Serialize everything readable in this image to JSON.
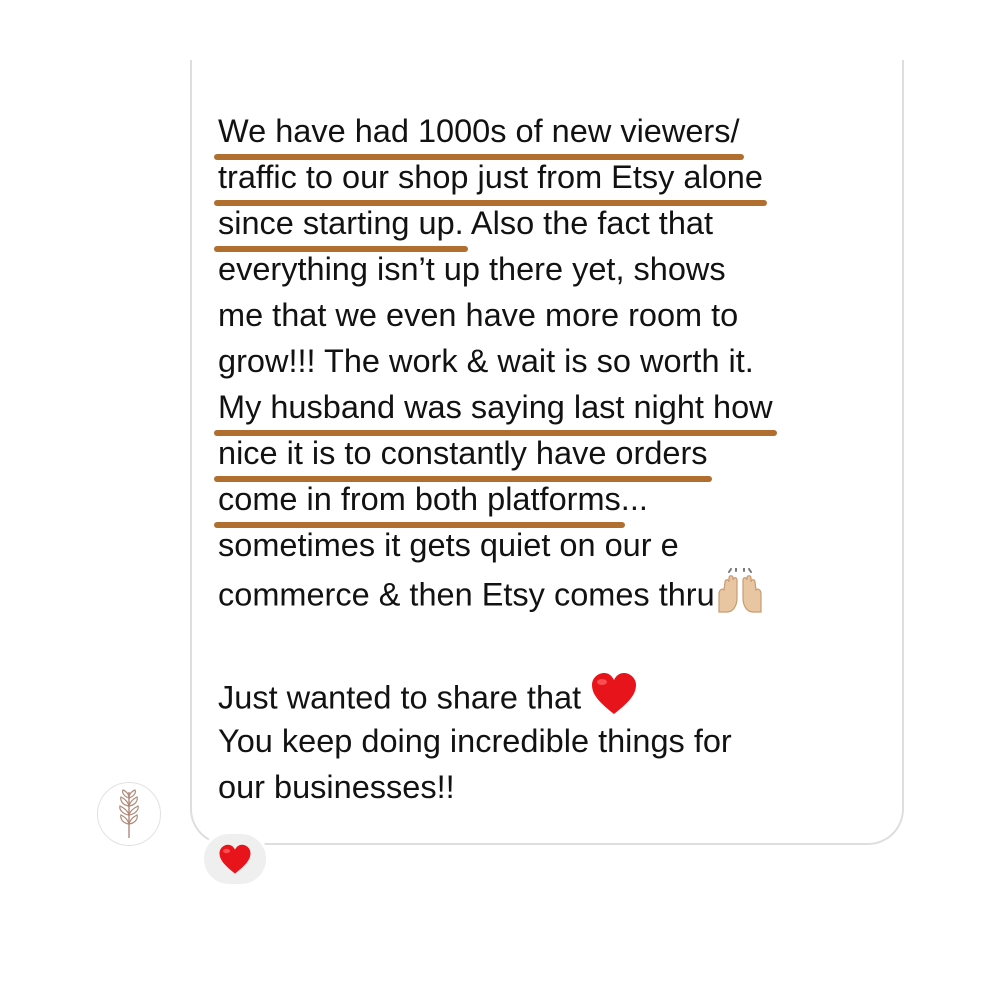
{
  "message": {
    "lines": [
      "We have had 1000s of new viewers/",
      "traffic to our shop just from Etsy alone",
      "since starting up.",
      " Also the fact that",
      "everything isn’t up there yet, shows",
      "me that we even have more room to",
      "grow!!! The work & wait is so worth it.",
      "My husband was saying last night how",
      "nice it is to constantly have orders",
      "come in from both platforms",
      "...",
      "sometimes it gets quiet on our e",
      "commerce & then Etsy comes thru",
      "Just wanted to share that ",
      "You keep doing incredible things for",
      "our businesses!!"
    ],
    "emoji_hands": "raising-hands-icon",
    "emoji_heart": "red-heart-icon"
  },
  "reaction": {
    "emoji": "red-heart-icon"
  },
  "sender": {
    "avatar": "leaf-branch-icon"
  },
  "colors": {
    "highlight": "#b06f2f",
    "text": "#121212",
    "bubble_border": "#dedede",
    "heart": "#e8141c",
    "reaction_bg": "#efefef"
  }
}
